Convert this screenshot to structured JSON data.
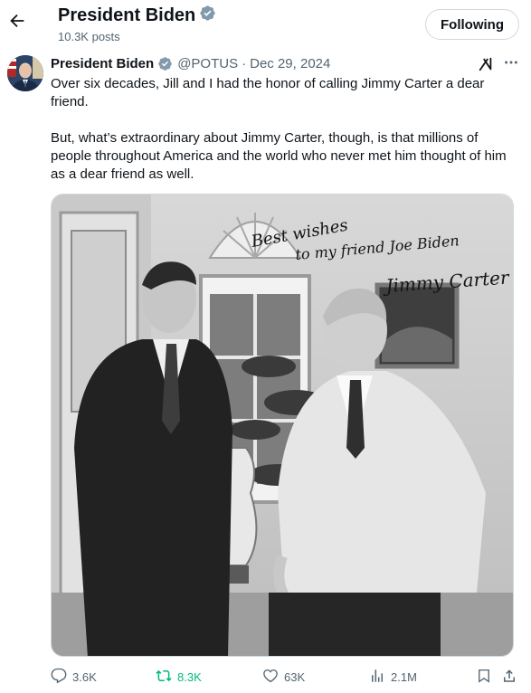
{
  "header": {
    "title": "President Biden",
    "post_count": "10.3K posts",
    "follow_label": "Following"
  },
  "post": {
    "author_name": "President Biden",
    "handle": "@POTUS",
    "separator": "·",
    "date": "Dec 29, 2024",
    "paragraphs": [
      "Over six decades, Jill and I had the honor of calling Jimmy Carter a dear friend.",
      "But, what’s extraordinary about Jimmy Carter, though, is that millions of people throughout America and the world who never met him thought of him as a dear friend as well."
    ],
    "photo": {
      "inscription_line1": "Best wishes",
      "inscription_line2": "to my friend Joe Biden",
      "signature": "Jimmy Carter"
    }
  },
  "actions": {
    "replies": "3.6K",
    "reposts": "8.3K",
    "likes": "63K",
    "views": "2.1M"
  },
  "colors": {
    "accent_verified": "#829aab",
    "repost_active": "#00ba7c",
    "secondary_text": "#536471"
  },
  "icons": [
    "back-arrow-icon",
    "verified-badge-icon",
    "grok-icon",
    "more-icon",
    "reply-icon",
    "repost-icon",
    "like-icon",
    "views-icon",
    "bookmark-icon",
    "share-icon"
  ]
}
